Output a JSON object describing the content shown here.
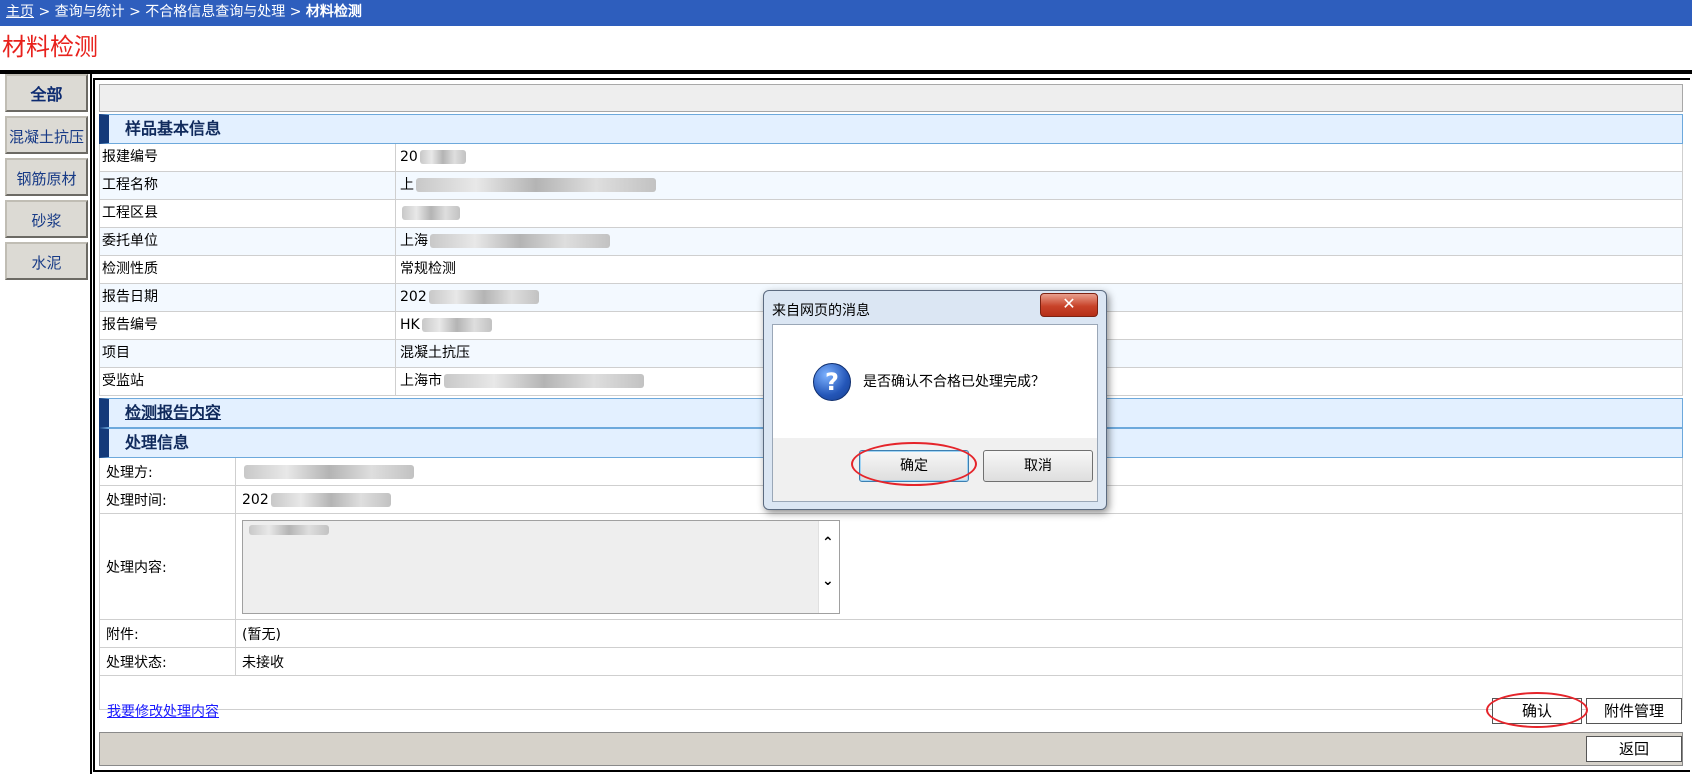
{
  "breadcrumb": {
    "home": "主页",
    "sep": ">",
    "level2": "查询与统计",
    "level3": "不合格信息查询与处理",
    "current": "材料检测"
  },
  "page_title": "材料检测",
  "sidebar": {
    "items": [
      {
        "label": "全部"
      },
      {
        "label": "混凝土抗压"
      },
      {
        "label": "钢筋原材"
      },
      {
        "label": "砂浆"
      },
      {
        "label": "水泥"
      }
    ]
  },
  "sample_info": {
    "header": "样品基本信息",
    "rows": [
      {
        "label": "报建编号",
        "value": "20"
      },
      {
        "label": "工程名称",
        "value": "上"
      },
      {
        "label": "工程区县",
        "value": ""
      },
      {
        "label": "委托单位",
        "value": "上海"
      },
      {
        "label": "检测性质",
        "value": "常规检测"
      },
      {
        "label": "报告日期",
        "value": "202"
      },
      {
        "label": "报告编号",
        "value": "HK"
      },
      {
        "label": "项目",
        "value": "混凝土抗压"
      },
      {
        "label": "受监站",
        "value": "上海市"
      }
    ]
  },
  "report_section": {
    "header": "检测报告内容"
  },
  "processing": {
    "header": "处理信息",
    "handler_label": "处理方:",
    "time_label": "处理时间:",
    "time_value": "202",
    "content_label": "处理内容:",
    "attachment_label": "附件:",
    "attachment_value": "(暂无)",
    "status_label": "处理状态:",
    "status_value": "未接收"
  },
  "actions": {
    "edit_link": "我要修改处理内容",
    "confirm": "确认",
    "attachment_mgmt": "附件管理",
    "back": "返回"
  },
  "dialog": {
    "title": "来自网页的消息",
    "close_glyph": "✕",
    "icon_glyph": "?",
    "message": "是否确认不合格已处理完成？",
    "ok": "确定",
    "cancel": "取消"
  },
  "icons": {
    "scroll_up": "⌃",
    "scroll_down": "⌄"
  },
  "colors": {
    "topbar": "#2e5ebd",
    "title_red": "#e8211c",
    "section_bg": "#e3f0ff",
    "annotation_red": "#e5242a"
  }
}
